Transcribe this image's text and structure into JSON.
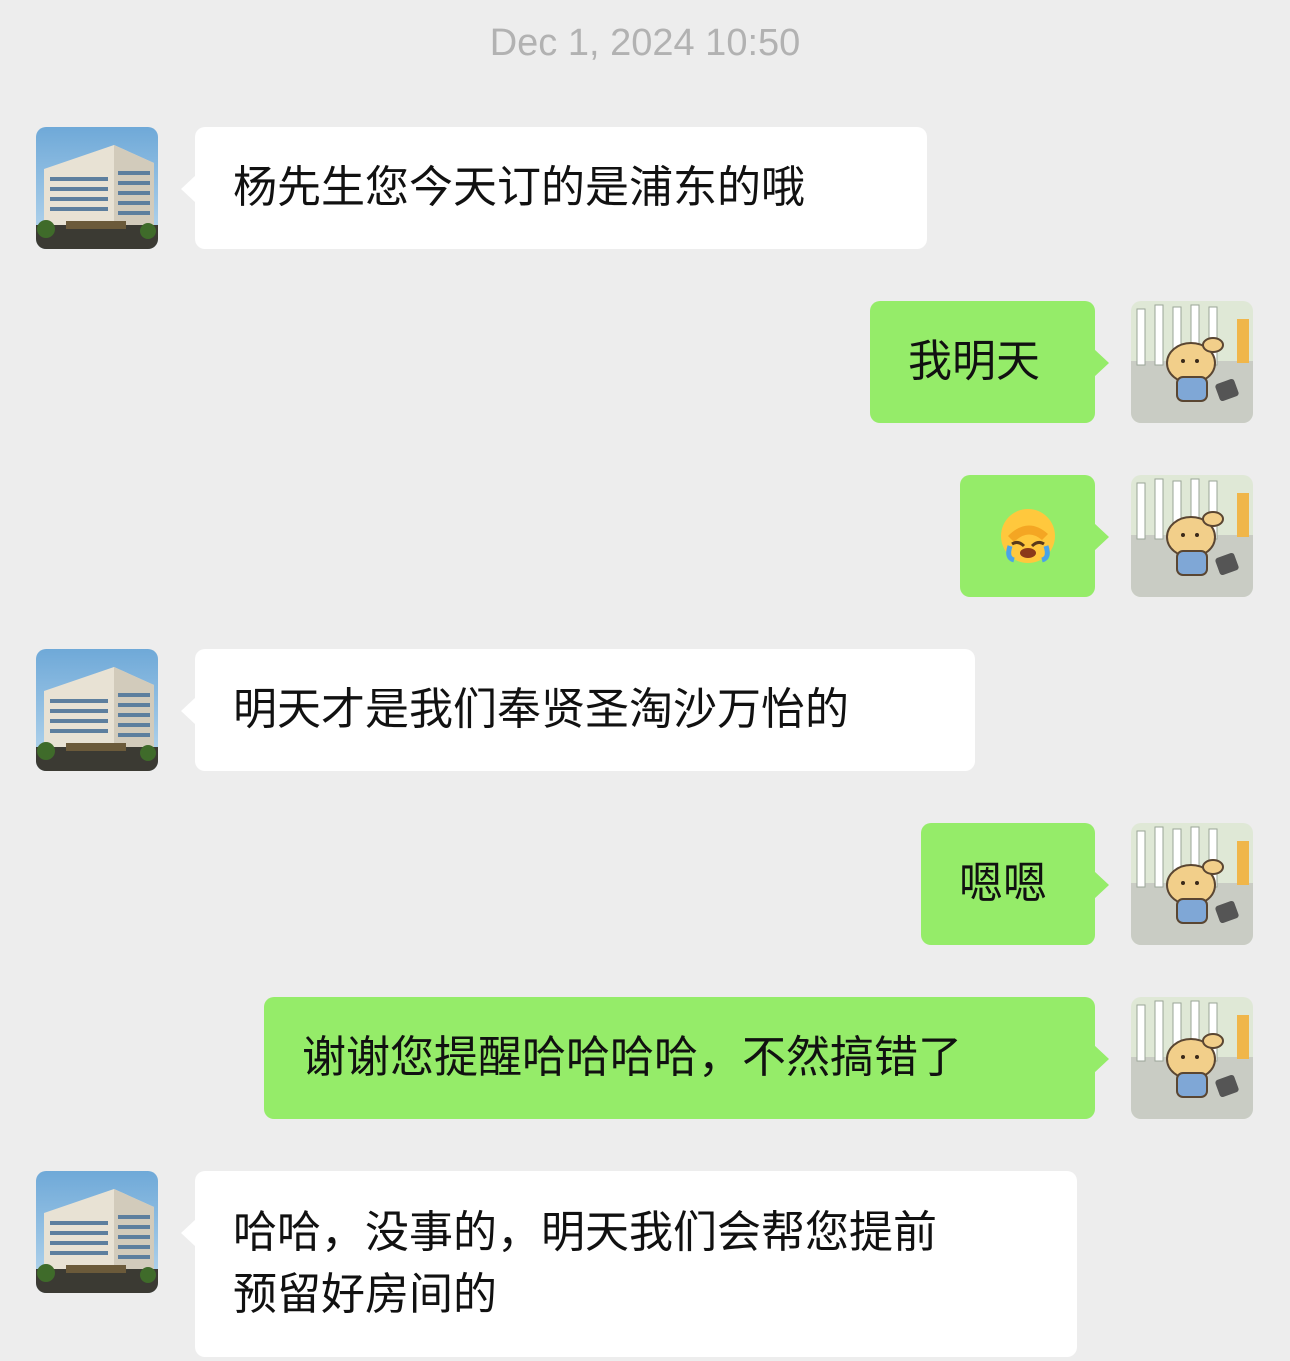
{
  "timestamp": "Dec 1, 2024 10:50",
  "messages": [
    {
      "side": "in",
      "text": "杨先生您今天订的是浦东的哦",
      "avatar": "hotel-building-avatar"
    },
    {
      "side": "out",
      "text": "我明天",
      "avatar": "cartoon-dog-avatar"
    },
    {
      "side": "out",
      "text": "",
      "emoji": "facepalm-crying-emoji",
      "avatar": "cartoon-dog-avatar"
    },
    {
      "side": "in",
      "text": "明天才是我们奉贤圣淘沙万怡的",
      "avatar": "hotel-building-avatar"
    },
    {
      "side": "out",
      "text": "嗯嗯",
      "avatar": "cartoon-dog-avatar"
    },
    {
      "side": "out",
      "text": "谢谢您提醒哈哈哈哈，不然搞错了",
      "avatar": "cartoon-dog-avatar"
    },
    {
      "side": "in",
      "text": "哈哈，没事的，明天我们会帮您提前\n预留好房间的",
      "avatar": "hotel-building-avatar"
    }
  ],
  "colors": {
    "background": "#ededed",
    "incoming_bubble": "#ffffff",
    "outgoing_bubble": "#95ec69",
    "timestamp": "#b2b2b2"
  }
}
